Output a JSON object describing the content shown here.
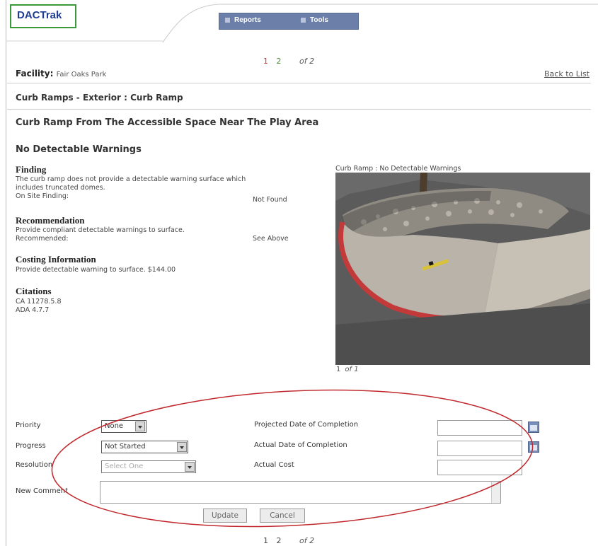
{
  "header": {
    "logo_text": "DACTrak",
    "nav": [
      {
        "label": "Reports",
        "icon": "report-icon"
      },
      {
        "label": "Tools",
        "icon": "tools-icon"
      }
    ]
  },
  "pager_top": {
    "pages": [
      "1",
      "2"
    ],
    "current": "1",
    "of_label": "of 2"
  },
  "pager_bottom": {
    "pages": [
      "1",
      "2"
    ],
    "of_label": "of 2"
  },
  "facility": {
    "label": "Facility:",
    "value": "Fair Oaks Park"
  },
  "back_link": "Back to List",
  "category": "Curb Ramps - Exterior : Curb Ramp",
  "item_title": "Curb Ramp From The Accessible Space Near The Play Area",
  "issue_title": "No Detectable Warnings",
  "finding": {
    "heading": "Finding",
    "text_line1": "The curb ramp does not provide a detectable warning surface which",
    "text_line2": "includes truncated domes.",
    "onsite_label": "On Site Finding:",
    "onsite_value": "Not Found"
  },
  "recommendation": {
    "heading": "Recommendation",
    "text": "Provide compliant detectable warnings to surface.",
    "recommended_label": "Recommended:",
    "recommended_value": "See Above"
  },
  "costing": {
    "heading": "Costing Information",
    "text": "Provide detectable warning to surface. $144.00"
  },
  "citations": {
    "heading": "Citations",
    "items": [
      "CA 11278.5.8",
      "ADA 4.7.7"
    ]
  },
  "photo": {
    "caption": "Curb Ramp : No Detectable Warnings",
    "pager_current": "1",
    "pager_of": "of 1"
  },
  "form": {
    "priority_label": "Priority",
    "priority_value": "None",
    "progress_label": "Progress",
    "progress_value": "Not Started",
    "resolution_label": "Resolution",
    "resolution_value": "Select One",
    "projected_label": "Projected Date of Completion",
    "actual_date_label": "Actual Date of Completion",
    "actual_cost_label": "Actual Cost",
    "comment_label": "New Comment",
    "update_label": "Update",
    "cancel_label": "Cancel"
  },
  "colors": {
    "logo_border": "#3d9a3a",
    "logo_text": "#1f3c95",
    "nav_bg": "#6c7fa8",
    "annotation_ellipse": "#c0282d",
    "curb_paint": "#c23a3a"
  }
}
